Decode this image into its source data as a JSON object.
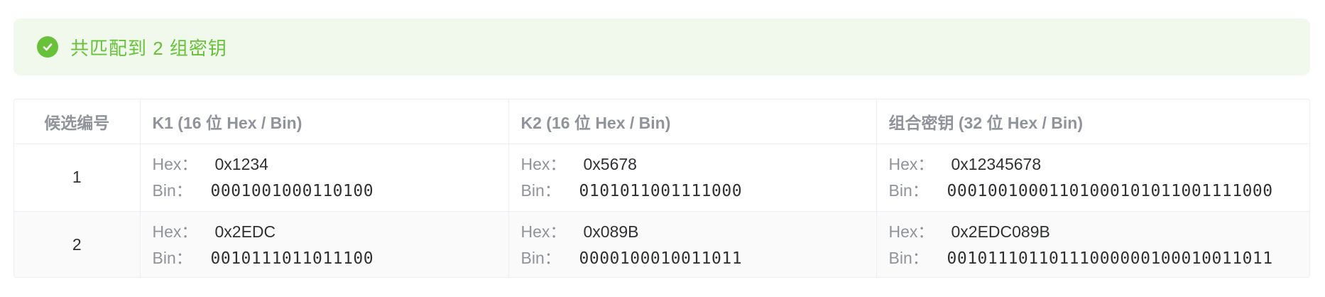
{
  "alert": {
    "title": "共匹配到 2 组密钥",
    "icon": "check-circle-icon",
    "color": "#67c23a",
    "background": "#f0f9eb"
  },
  "table": {
    "headers": [
      "候选编号",
      "K1 (16 位 Hex / Bin)",
      "K2 (16 位 Hex / Bin)",
      "组合密钥 (32 位 Hex / Bin)"
    ],
    "hex_label": "Hex：",
    "bin_label": "Bin：",
    "rows": [
      {
        "index": "1",
        "k1": {
          "hex": "0x1234",
          "bin": "0001001000110100"
        },
        "k2": {
          "hex": "0x5678",
          "bin": "0101011001111000"
        },
        "combined": {
          "hex": "0x12345678",
          "bin": "00010010001101000101011001111000"
        }
      },
      {
        "index": "2",
        "k1": {
          "hex": "0x2EDC",
          "bin": "0010111011011100"
        },
        "k2": {
          "hex": "0x089B",
          "bin": "0000100010011011"
        },
        "combined": {
          "hex": "0x2EDC089B",
          "bin": "00101110110111000000100010011011"
        }
      }
    ]
  }
}
